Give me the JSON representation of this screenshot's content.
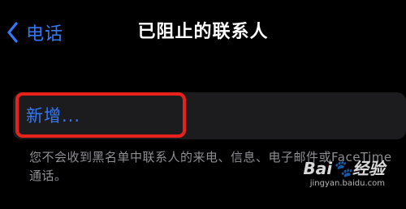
{
  "nav": {
    "back_label": "电话",
    "title": "已阻止的联系人"
  },
  "list": {
    "add_label": "新增..."
  },
  "footer_text": "您不会收到黑名单中联系人的来电、信息、电子邮件或FaceTime通话。",
  "watermark": {
    "logo": "Bai🐾经验",
    "url": "jingyan.baidu.com"
  },
  "colors": {
    "background": "#000000",
    "accent": "#3478f6",
    "group_bg": "#1c1c1e",
    "highlight_border": "#e8221b",
    "secondary_text": "#8e8e93"
  },
  "icons": {
    "back": "chevron-left-icon"
  }
}
